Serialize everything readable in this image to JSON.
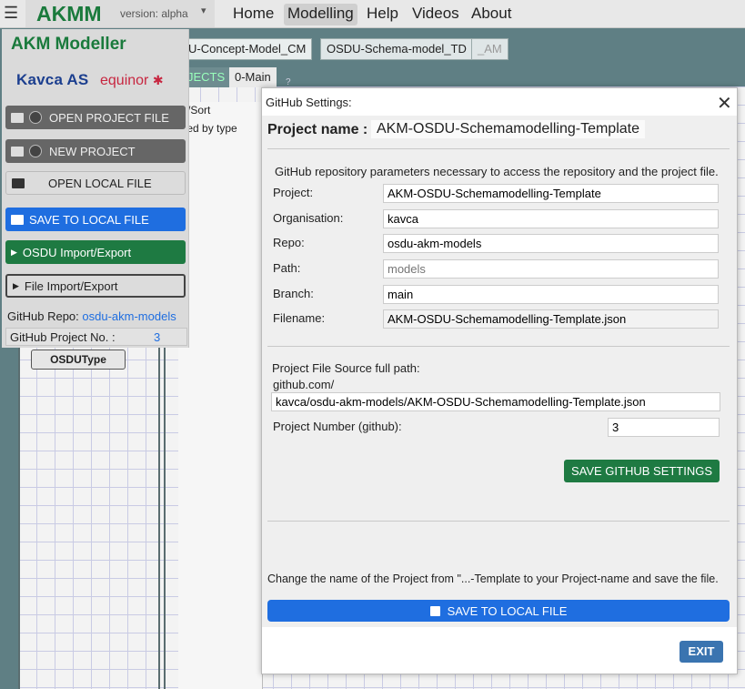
{
  "topbar": {
    "menu_icon": "hamburger-icon",
    "brand": "AKMM",
    "version": "version: alpha",
    "nav": [
      "Home",
      "Modelling",
      "Help",
      "Videos",
      "About"
    ]
  },
  "model_tabs": [
    "U-Concept-Model_CM",
    "OSDU-Schema-model_TD",
    "_AM"
  ],
  "sub_tabs": [
    "JECTS",
    "0-Main",
    "?"
  ],
  "filter": {
    "line1": "r/Sort",
    "line2": "ted by type"
  },
  "sidebar": {
    "title": "AKM Modeller",
    "logo_kavca": "Kavca AS",
    "logo_equinor": "equinor",
    "buttons": {
      "open_project": "OPEN PROJECT FILE",
      "new_project": "NEW PROJECT",
      "open_local": "OPEN LOCAL FILE",
      "save_local": "SAVE TO LOCAL FILE",
      "osdu": "OSDU Import/Export",
      "file_ie": "File Import/Export"
    },
    "github_repo_label": "GitHub Repo:",
    "github_repo_value": "osdu-akm-models",
    "github_project_label": "GitHub Project No. :",
    "github_project_value": "3"
  },
  "canvas": {
    "node_label": "OSDUType"
  },
  "modal": {
    "title": "GitHub Settings:",
    "project_name_label": "Project name :",
    "project_name_value": "AKM-OSDU-Schemamodelling-Template",
    "intro": "GitHub repository parameters necessary to access the repository and the project file.",
    "fields": {
      "project": {
        "label": "Project:",
        "value": "AKM-OSDU-Schemamodelling-Template"
      },
      "organisation": {
        "label": "Organisation:",
        "value": "kavca"
      },
      "repo": {
        "label": "Repo:",
        "value": "osdu-akm-models"
      },
      "path": {
        "label": "Path:",
        "placeholder": "models"
      },
      "branch": {
        "label": "Branch:",
        "value": "main"
      },
      "filename": {
        "label": "Filename:",
        "value": "AKM-OSDU-Schemamodelling-Template.json"
      }
    },
    "source_label": "Project File Source full path:",
    "source_prefix": "github.com/",
    "source_value": "kavca/osdu-akm-models/AKM-OSDU-Schemamodelling-Template.json",
    "project_number_label": "Project Number (github):",
    "project_number_value": "3",
    "save_github_label": "SAVE GITHUB SETTINGS",
    "footer_note": "Change the name of the Project from \"...-Template to your Project-name and save the file.",
    "save_local_label": "SAVE TO LOCAL FILE",
    "exit_label": "EXIT"
  },
  "colors": {
    "brand_green": "#1a7a3c",
    "primary_blue": "#1f6ee0",
    "exit_blue": "#3a74b0"
  }
}
